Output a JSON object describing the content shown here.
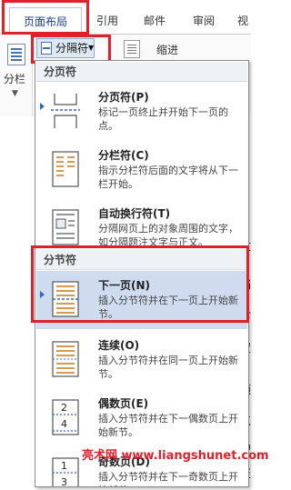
{
  "tabs": [
    "页面布局",
    "引用",
    "邮件",
    "审阅",
    "视"
  ],
  "ribbon": {
    "left_group_label": "分栏",
    "separator_button_label": "分隔符",
    "indent_label": "缩进"
  },
  "doc_fragments": [
    "1",
    "\"",
    "\"",
    "文",
    "档",
    "下",
    "置",
    "项",
    "点",
    "中",
    "至"
  ],
  "menu": {
    "page_break_header": "分页符",
    "section_break_header": "分节符",
    "items": [
      {
        "title": "分页符(P)",
        "desc": "标记一页终止并开始下一页的点。",
        "icon": "page-break-icon"
      },
      {
        "title": "分栏符(C)",
        "desc": "指示分栏符后面的文字将从下一栏开始。",
        "icon": "column-break-icon"
      },
      {
        "title": "自动换行符(T)",
        "desc": "分隔网页上的对象周围的文字，如分隔题注文字与正文。",
        "icon": "text-wrap-break-icon"
      },
      {
        "title": "下一页(N)",
        "desc": "插入分节符并在下一页上开始新节。",
        "icon": "next-page-section-icon"
      },
      {
        "title": "连续(O)",
        "desc": "插入分节符并在同一页上开始新节。",
        "icon": "continuous-section-icon"
      },
      {
        "title": "偶数页(E)",
        "desc": "插入分节符并在下一偶数页上开始新节。",
        "icon": "even-page-section-icon"
      },
      {
        "title": "奇数页(D)",
        "desc": "插入分节符并在下一奇数页上开始新节。",
        "icon": "odd-page-section-icon"
      }
    ]
  },
  "watermark": "亮术网 www.liangshunet.com",
  "colors": {
    "highlight": "#e0202a",
    "selected_bg": "#cfdcf0",
    "accent": "#3567c0"
  }
}
